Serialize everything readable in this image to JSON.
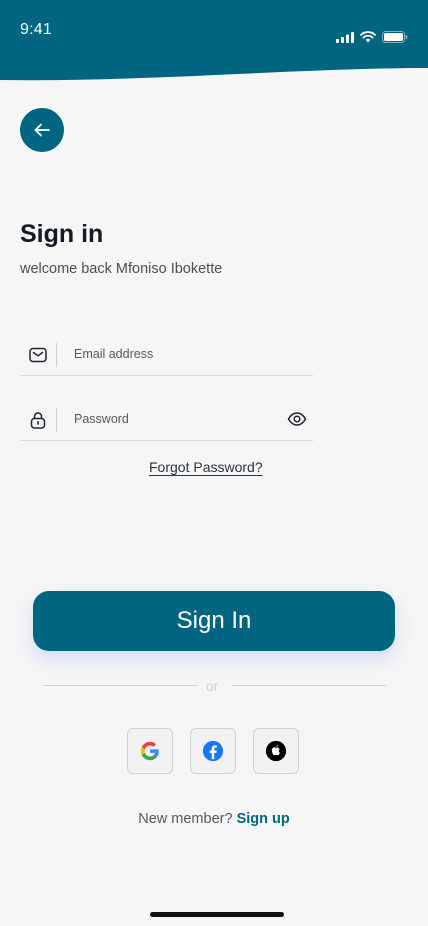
{
  "status_bar": {
    "time": "9:41"
  },
  "header": {
    "back_icon": "arrow-left-icon",
    "title": "Sign in",
    "subtitle": "welcome back Mfoniso Ibokette"
  },
  "form": {
    "email": {
      "icon": "mail-icon",
      "placeholder": "Email address",
      "value": ""
    },
    "password": {
      "icon": "lock-icon",
      "placeholder": "Password",
      "value": "",
      "toggle_icon": "eye-icon"
    },
    "forgot_password_label": "Forgot Password?",
    "submit_label": "Sign In"
  },
  "divider": {
    "label": "or"
  },
  "social": [
    {
      "provider": "Google",
      "icon": "google-icon"
    },
    {
      "provider": "Facebook",
      "icon": "facebook-icon"
    },
    {
      "provider": "Apple",
      "icon": "apple-icon"
    }
  ],
  "footer": {
    "prompt": "New member?",
    "signup_label": "Sign up"
  },
  "colors": {
    "primary": "#006580",
    "background": "#f6f6f6",
    "title": "#121a24"
  }
}
